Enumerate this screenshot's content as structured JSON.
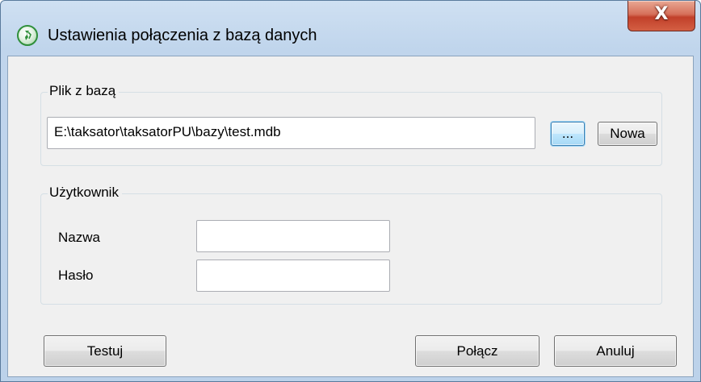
{
  "window": {
    "title": "Ustawienia połączenia z bazą danych",
    "app_icon": "app-logo-icon",
    "close_glyph": "X"
  },
  "database_group": {
    "legend": "Plik z bazą",
    "path_value": "E:\\taksator\\taksatorPU\\bazy\\test.mdb",
    "browse_label": "...",
    "new_label": "Nowa"
  },
  "user_group": {
    "legend": "Użytkownik",
    "name_label": "Nazwa",
    "name_value": "",
    "password_label": "Hasło",
    "password_value": ""
  },
  "footer": {
    "test_label": "Testuj",
    "connect_label": "Połącz",
    "cancel_label": "Anuluj"
  },
  "colors": {
    "window_frame": "#bcd2ea",
    "client_background": "#f0f0f0",
    "close_button": "#c2402a",
    "focused_button_border": "#3c7fb1"
  }
}
